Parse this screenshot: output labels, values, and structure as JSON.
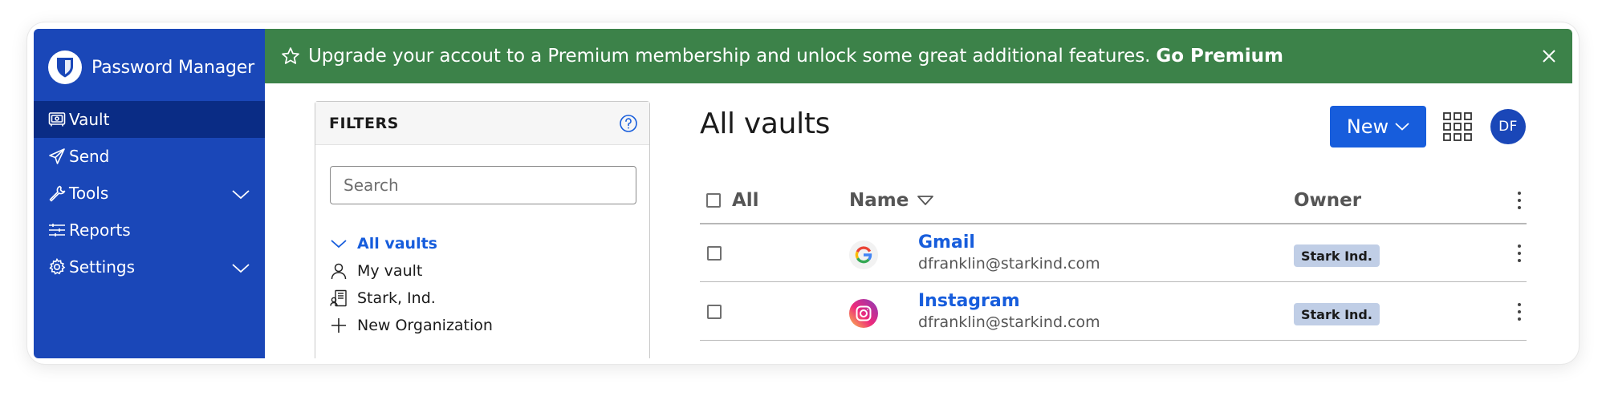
{
  "app": {
    "name": "Password Manager"
  },
  "sidebar": {
    "items": [
      {
        "label": "Vault",
        "icon": "vault-icon",
        "active": true
      },
      {
        "label": "Send",
        "icon": "send-icon"
      },
      {
        "label": "Tools",
        "icon": "wrench-icon",
        "expandable": true
      },
      {
        "label": "Reports",
        "icon": "sliders-icon"
      },
      {
        "label": "Settings",
        "icon": "gear-icon",
        "expandable": true
      }
    ]
  },
  "banner": {
    "text": "Upgrade your accout to a Premium membership and unlock some great additional features.",
    "link": "Go Premium",
    "color": "#3c8249"
  },
  "filters": {
    "title": "FILTERS",
    "search_placeholder": "Search",
    "items": [
      {
        "label": "All vaults",
        "icon": "chevron-down-icon",
        "selected": true
      },
      {
        "label": "My vault",
        "icon": "user-icon"
      },
      {
        "label": "Stark, Ind.",
        "icon": "organization-icon"
      },
      {
        "label": "New Organization",
        "icon": "plus-icon"
      }
    ]
  },
  "main": {
    "title": "All vaults",
    "new_button": "New",
    "avatar_initials": "DF",
    "table": {
      "columns": {
        "select_all": "All",
        "name": "Name",
        "owner": "Owner"
      },
      "rows": [
        {
          "name": "Gmail",
          "username": "dfranklin@starkind.com",
          "owner": "Stark Ind.",
          "icon": "google-icon"
        },
        {
          "name": "Instagram",
          "username": "dfranklin@starkind.com",
          "owner": "Stark Ind.",
          "icon": "instagram-icon"
        }
      ]
    }
  },
  "colors": {
    "sidebar": "#1a47b8",
    "sidebar_active": "#0a2c85",
    "accent": "#175ddc",
    "badge": "#c0cee6"
  }
}
